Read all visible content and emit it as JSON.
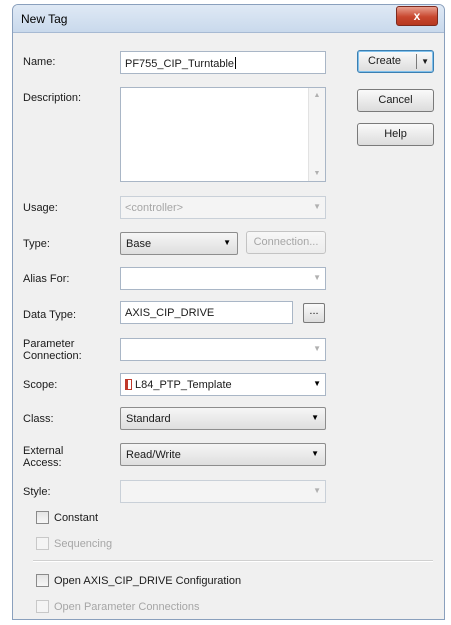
{
  "window": {
    "title": "New Tag",
    "close_glyph": "x"
  },
  "buttons": {
    "create": "Create",
    "cancel": "Cancel",
    "help": "Help",
    "connection": "Connection...",
    "browse": "..."
  },
  "form": {
    "name": {
      "label": "Name:",
      "value": "PF755_CIP_Turntable"
    },
    "description": {
      "label": "Description:",
      "value": ""
    },
    "usage": {
      "label": "Usage:",
      "value": "<controller>",
      "enabled": false
    },
    "type": {
      "label": "Type:",
      "value": "Base"
    },
    "alias_for": {
      "label": "Alias For:",
      "value": ""
    },
    "data_type": {
      "label": "Data Type:",
      "value": "AXIS_CIP_DRIVE"
    },
    "parameter_connection": {
      "label_line1": "Parameter",
      "label_line2": "Connection:",
      "value": ""
    },
    "scope": {
      "label": "Scope:",
      "value": "L84_PTP_Template",
      "icon": "controller-scope-icon"
    },
    "class": {
      "label": "Class:",
      "value": "Standard"
    },
    "external_access": {
      "label_line1": "External",
      "label_line2": "Access:",
      "value": "Read/Write"
    },
    "style": {
      "label": "Style:",
      "value": ""
    }
  },
  "checkboxes": {
    "constant": {
      "label": "Constant",
      "checked": false,
      "enabled": true
    },
    "sequencing": {
      "label": "Sequencing",
      "checked": false,
      "enabled": false
    },
    "open_configuration": {
      "label": "Open AXIS_CIP_DRIVE Configuration",
      "checked": false,
      "enabled": true
    },
    "open_parameter_connections": {
      "label": "Open Parameter Connections",
      "checked": false,
      "enabled": false
    }
  },
  "icons": {
    "dropdown": "chevron-down-icon",
    "scroll_up": "scroll-up-arrow-icon",
    "scroll_down": "scroll-down-arrow-icon"
  }
}
